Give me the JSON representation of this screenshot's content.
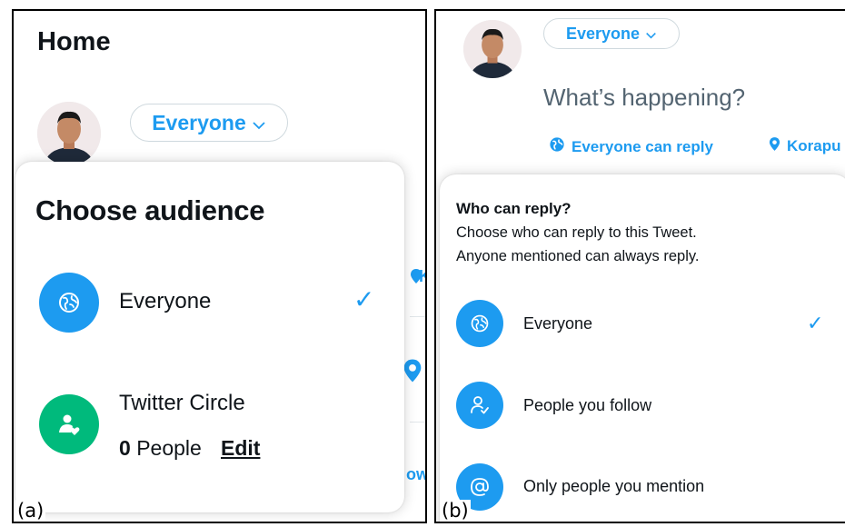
{
  "panel_a": {
    "label": "(a)",
    "home_title": "Home",
    "audience_button": "Everyone",
    "peek_top": "K",
    "peek_bottom": "ow",
    "popover": {
      "title": "Choose audience",
      "options": [
        {
          "label": "Everyone",
          "icon": "globe-icon",
          "selected": true
        },
        {
          "label": "Twitter Circle",
          "icon": "circle-people-icon",
          "count": "0",
          "count_suffix": "People",
          "action": "Edit"
        }
      ]
    }
  },
  "panel_b": {
    "label": "(b)",
    "audience_button": "Everyone",
    "placeholder": "What’s happening?",
    "reply_setting": "Everyone can reply",
    "location": "Korapu",
    "popover": {
      "title": "Who can reply?",
      "description_line1": "Choose who can reply to this Tweet.",
      "description_line2": "Anyone mentioned can always reply.",
      "options": [
        {
          "label": "Everyone",
          "icon": "globe-icon",
          "selected": true
        },
        {
          "label": "People you follow",
          "icon": "follow-person-icon"
        },
        {
          "label": "Only people you mention",
          "icon": "at-sign-icon"
        }
      ]
    }
  },
  "colors": {
    "accent": "#1d9bf0",
    "circle_green": "#00ba7c",
    "text": "#0f1419",
    "muted": "#536471"
  }
}
